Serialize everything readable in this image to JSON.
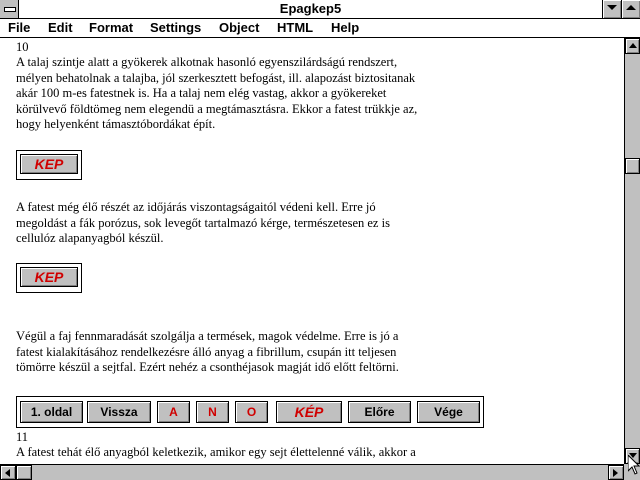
{
  "window": {
    "title": "Epagkep5",
    "system_menu_icon": "system-menu-icon",
    "minimize_icon": "minimize-arrow-icon",
    "maximize_icon": "maximize-arrow-icon"
  },
  "menu": [
    {
      "label": "File"
    },
    {
      "label": "Edit"
    },
    {
      "label": "Format"
    },
    {
      "label": "Settings"
    },
    {
      "label": "Object"
    },
    {
      "label": "HTML"
    },
    {
      "label": "Help"
    }
  ],
  "document": {
    "page10_number": "10",
    "para1": [
      "A talaj szintje alatt a gyökerek alkotnak hasonló egyenszilárdságú rendszert,",
      "mélyen behatolnak a talajba, jól szerkesztett befogást, ill. alapozást biztositanak",
      "akár 100 m-es fatestnek is. Ha a talaj nem elég vastag, akkor a gyökereket",
      "körülvevő földtömeg nem elegendü a megtámasztásra. Ekkor a fatest trükkje az,",
      "hogy helyenként támasztóbordákat épít."
    ],
    "kep_button_1": "KEP",
    "para2": [
      "A fatest még élő részét az időjárás viszontagságaitól védeni kell. Erre jó",
      "megoldást a fák porózus, sok levegőt tartalmazó kérge, természetesen ez is",
      "cellulóz alapanyagból készül."
    ],
    "kep_button_2": "KEP",
    "para3": [
      "Végül a faj fennmaradását szolgálja a termések, magok védelme. Erre is jó a",
      "fatest kialakításához rendelkezésre álló anyag a fibrillum, csupán itt teljesen",
      "tömörre készül a sejtfal. Ezért nehéz a csonthéjasok magját idő előtt feltörni."
    ],
    "navbar": {
      "first_page": "1. oldal",
      "back": "Vissza",
      "a": "A",
      "n": "N",
      "o": "O",
      "kep": "KÉP",
      "forward": "Előre",
      "end": "Vége"
    },
    "page11_number": "11",
    "para4": [
      "A fatest tehát élő anyagból keletkezik, amikor egy sejt élettelenné válik, akkor a"
    ]
  },
  "colors": {
    "accent_red": "#d00000",
    "chrome_gray": "#c0c0c0"
  },
  "scrollbars": {
    "up_icon": "scroll-up-arrow-icon",
    "down_icon": "scroll-down-arrow-icon",
    "left_icon": "scroll-left-arrow-icon",
    "right_icon": "scroll-right-arrow-icon"
  }
}
